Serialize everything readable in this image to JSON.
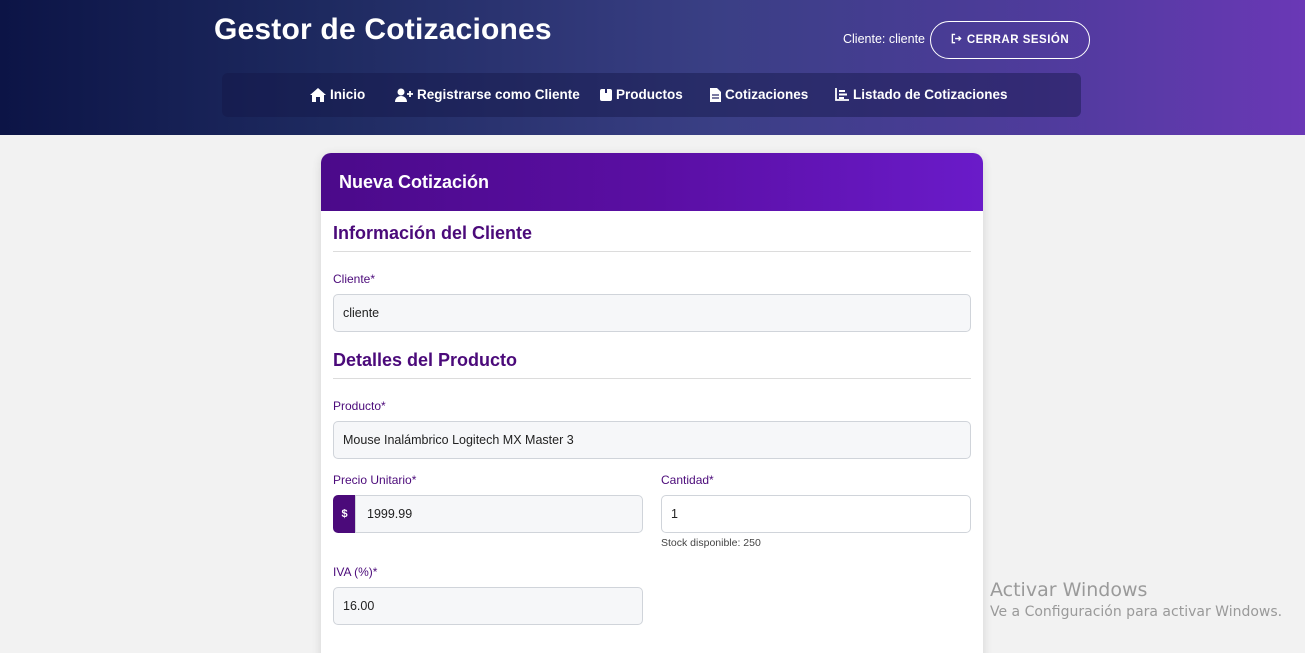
{
  "header": {
    "app_title": "Gestor de Cotizaciones",
    "user_label": "Cliente: cliente",
    "logout_label": "CERRAR SESIÓN"
  },
  "nav": {
    "items": [
      {
        "label": "Inicio",
        "icon": "home-icon"
      },
      {
        "label": "Registrarse como Cliente",
        "icon": "user-plus-icon"
      },
      {
        "label": "Productos",
        "icon": "box-icon"
      },
      {
        "label": "Cotizaciones",
        "icon": "file-icon"
      },
      {
        "label": "Listado de Cotizaciones",
        "icon": "chart-list-icon"
      }
    ]
  },
  "form": {
    "title": "Nueva Cotización",
    "client_section": {
      "title": "Información del Cliente",
      "client_label": "Cliente*",
      "client_value": "cliente"
    },
    "product_section": {
      "title": "Detalles del Producto",
      "product_label": "Producto*",
      "product_value": "Mouse Inalámbrico Logitech MX Master 3",
      "unit_price_label": "Precio Unitario*",
      "currency_prefix": "$",
      "unit_price_value": "1999.99",
      "quantity_label": "Cantidad*",
      "quantity_value": "1",
      "stock_text": "Stock disponible: 250",
      "iva_label": "IVA (%)*",
      "iva_value": "16.00"
    }
  },
  "watermark": {
    "title": "Activar Windows",
    "subtitle": "Ve a Configuración para activar Windows."
  },
  "colors": {
    "accent": "#4b0a7a",
    "header_gradient_start": "#0c1446",
    "header_gradient_end": "#6a38b6"
  }
}
